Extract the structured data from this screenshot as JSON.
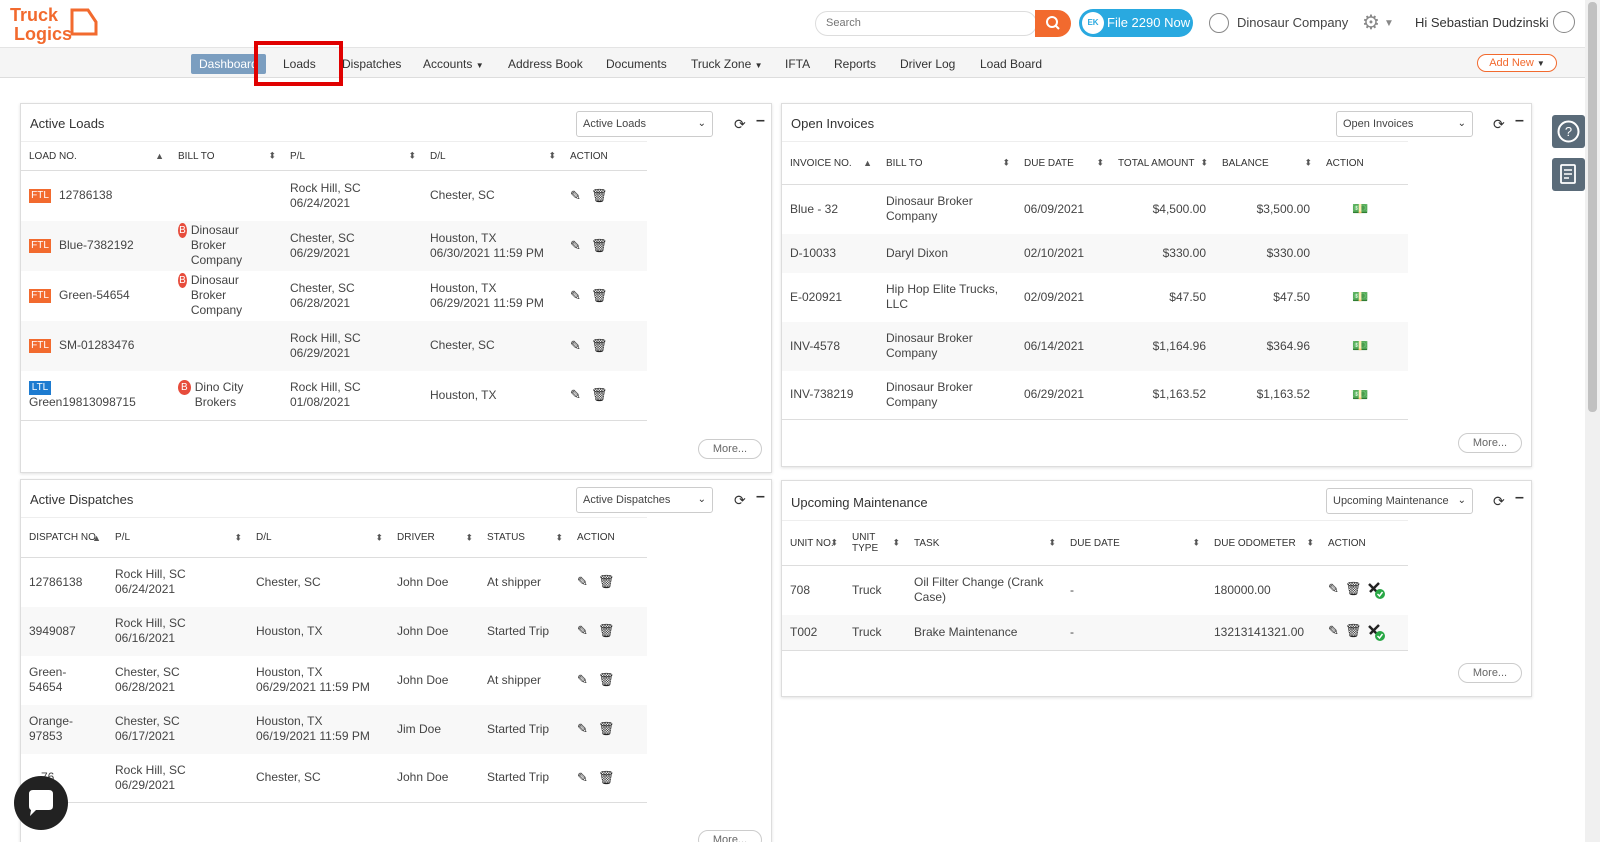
{
  "header": {
    "search_placeholder": "Search",
    "file_button": "File 2290 Now",
    "file_logo": "EK",
    "company": "Dinosaur Company",
    "greeting": "Hi Sebastian Dudzinski"
  },
  "nav": {
    "items": [
      "Dashboard",
      "Loads",
      "Dispatches",
      "Accounts",
      "Address Book",
      "Documents",
      "Truck Zone",
      "IFTA",
      "Reports",
      "Driver Log",
      "Load Board"
    ],
    "add_new": "Add New"
  },
  "active_loads": {
    "title": "Active Loads",
    "select": "Active Loads",
    "more": "More...",
    "columns": [
      "LOAD NO.",
      "BILL TO",
      "P/L",
      "D/L",
      "ACTION"
    ],
    "rows": [
      {
        "type": "FTL",
        "load_no": "12786138",
        "bill_to": "",
        "pl1": "Rock Hill, SC",
        "pl2": "06/24/2021",
        "dl1": "Chester, SC",
        "dl2": ""
      },
      {
        "type": "FTL",
        "load_no": "Blue-7382192",
        "bill_to": "Dinosaur Broker Company",
        "pl1": "Chester, SC",
        "pl2": "06/29/2021",
        "dl1": "Houston, TX",
        "dl2": "06/30/2021 11:59 PM"
      },
      {
        "type": "FTL",
        "load_no": "Green-54654",
        "bill_to": "Dinosaur Broker Company",
        "pl1": "Chester, SC",
        "pl2": "06/28/2021",
        "dl1": "Houston, TX",
        "dl2": "06/29/2021 11:59 PM"
      },
      {
        "type": "FTL",
        "load_no": "SM-01283476",
        "bill_to": "",
        "pl1": "Rock Hill, SC",
        "pl2": "06/29/2021",
        "dl1": "Chester, SC",
        "dl2": ""
      },
      {
        "type": "LTL",
        "load_no": "Green19813098715",
        "bill_to": "Dino City Brokers",
        "pl1": "Rock Hill, SC",
        "pl2": "01/08/2021",
        "dl1": "Houston, TX",
        "dl2": ""
      }
    ]
  },
  "active_dispatches": {
    "title": "Active Dispatches",
    "select": "Active Dispatches",
    "more": "More...",
    "columns": [
      "DISPATCH NO.",
      "P/L",
      "D/L",
      "DRIVER",
      "STATUS",
      "ACTION"
    ],
    "rows": [
      {
        "no": "12786138",
        "pl1": "Rock Hill, SC",
        "pl2": "06/24/2021",
        "dl1": "Chester, SC",
        "dl2": "",
        "driver": "John Doe",
        "status": "At shipper"
      },
      {
        "no": "3949087",
        "pl1": "Rock Hill, SC",
        "pl2": "06/16/2021",
        "dl1": "Houston, TX",
        "dl2": "",
        "driver": "John Doe",
        "status": "Started Trip"
      },
      {
        "no": "Green-54654",
        "pl1": "Chester, SC",
        "pl2": "06/28/2021",
        "dl1": "Houston, TX",
        "dl2": "06/29/2021 11:59 PM",
        "driver": "John Doe",
        "status": "At shipper"
      },
      {
        "no": "Orange-97853",
        "pl1": "Chester, SC",
        "pl2": "06/17/2021",
        "dl1": "Houston, TX",
        "dl2": "06/19/2021 11:59 PM",
        "driver": "Jim Doe",
        "status": "Started Trip"
      },
      {
        "no": "…76",
        "pl1": "Rock Hill, SC",
        "pl2": "06/29/2021",
        "dl1": "Chester, SC",
        "dl2": "",
        "driver": "John Doe",
        "status": "Started Trip"
      }
    ]
  },
  "open_invoices": {
    "title": "Open Invoices",
    "select": "Open Invoices",
    "more": "More...",
    "columns": [
      "INVOICE NO.",
      "BILL TO",
      "DUE DATE",
      "TOTAL AMOUNT",
      "BALANCE",
      "ACTION"
    ],
    "rows": [
      {
        "no": "Blue - 32",
        "bill_to": "Dinosaur Broker Company",
        "due": "06/09/2021",
        "total": "$4,500.00",
        "balance": "$3,500.00",
        "action": true
      },
      {
        "no": "D-10033",
        "bill_to": "Daryl Dixon",
        "due": "02/10/2021",
        "total": "$330.00",
        "balance": "$330.00",
        "action": false
      },
      {
        "no": "E-020921",
        "bill_to": "Hip Hop Elite Trucks, LLC",
        "due": "02/09/2021",
        "total": "$47.50",
        "balance": "$47.50",
        "action": true
      },
      {
        "no": "INV-4578",
        "bill_to": "Dinosaur Broker Company",
        "due": "06/14/2021",
        "total": "$1,164.96",
        "balance": "$364.96",
        "action": true
      },
      {
        "no": "INV-738219",
        "bill_to": "Dinosaur Broker Company",
        "due": "06/29/2021",
        "total": "$1,163.52",
        "balance": "$1,163.52",
        "action": true
      }
    ]
  },
  "upcoming_maintenance": {
    "title": "Upcoming Maintenance",
    "select": "Upcoming Maintenance",
    "more": "More...",
    "columns": [
      "UNIT NO.",
      "UNIT TYPE",
      "TASK",
      "DUE DATE",
      "DUE ODOMETER",
      "ACTION"
    ],
    "rows": [
      {
        "unit": "708",
        "type": "Truck",
        "task": "Oil Filter Change (Crank Case)",
        "due": "-",
        "odo": "180000.00"
      },
      {
        "unit": "T002",
        "type": "Truck",
        "task": "Brake Maintenance",
        "due": "-",
        "odo": "13213141321.00"
      }
    ]
  },
  "colors": {
    "brand_orange": "#f26a2e",
    "file_blue": "#29a9e0",
    "ltl_blue": "#1d7bd0",
    "nav_active": "#7b9ec0",
    "highlight_red": "#e00000"
  }
}
